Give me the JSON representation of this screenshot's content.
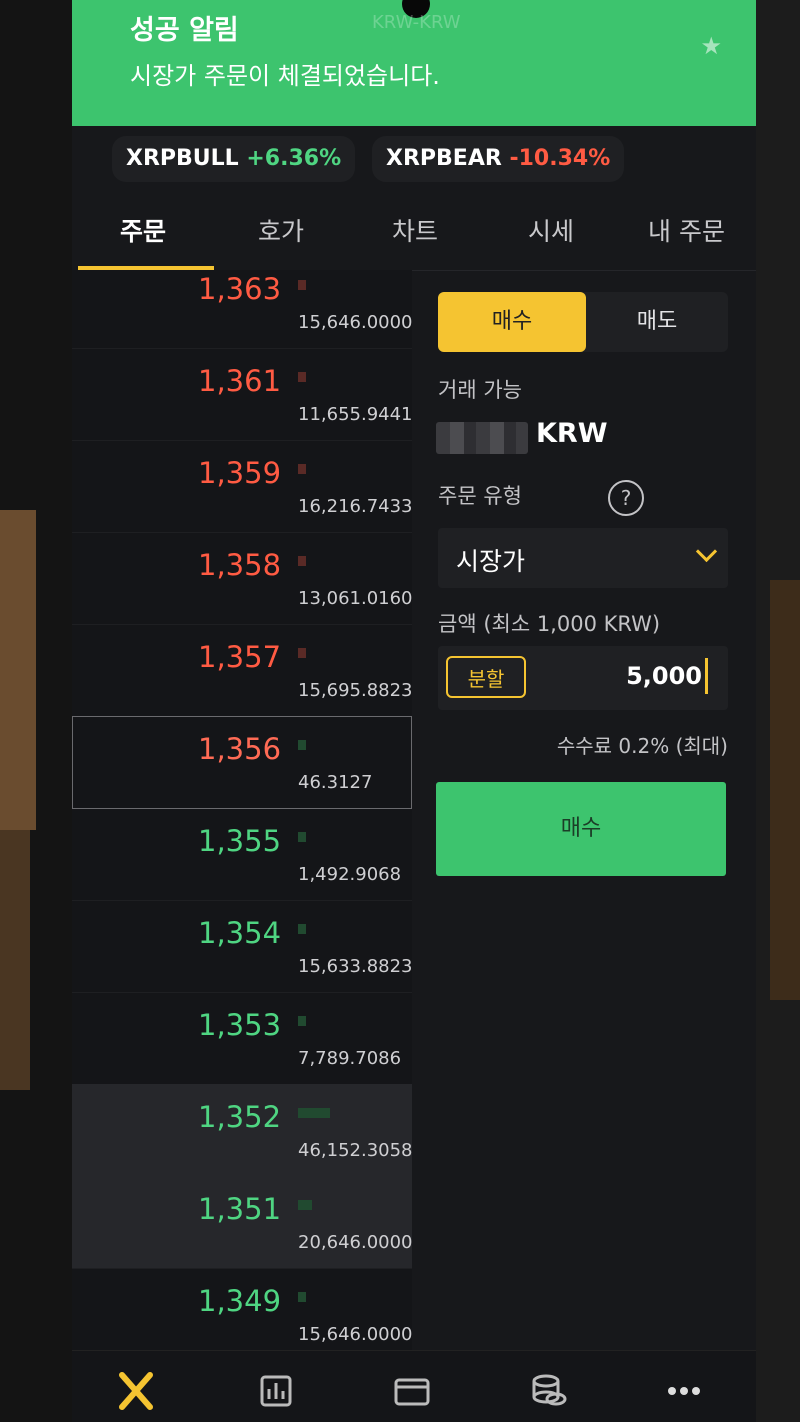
{
  "notification": {
    "title": "성공 알림",
    "message": "시장가 주문이 체결되었습니다.",
    "ghost_text": "KRW-KRW"
  },
  "tickers": [
    {
      "symbol": "XRPBULL",
      "change": "+6.36%",
      "direction": "up"
    },
    {
      "symbol": "XRPBEAR",
      "change": "-10.34%",
      "direction": "down"
    }
  ],
  "tabs": [
    {
      "label": "주문",
      "active": true
    },
    {
      "label": "호가",
      "active": false
    },
    {
      "label": "차트",
      "active": false
    },
    {
      "label": "시세",
      "active": false
    },
    {
      "label": "내 주문",
      "active": false
    }
  ],
  "orderbook": [
    {
      "price": "1,363",
      "qty": "15,646.0000",
      "side": "ask"
    },
    {
      "price": "1,361",
      "qty": "11,655.9441",
      "side": "ask"
    },
    {
      "price": "1,359",
      "qty": "16,216.7433",
      "side": "ask"
    },
    {
      "price": "1,358",
      "qty": "13,061.0160",
      "side": "ask"
    },
    {
      "price": "1,357",
      "qty": "15,695.8823",
      "side": "ask"
    },
    {
      "price": "1,356",
      "qty": "46.3127",
      "side": "current"
    },
    {
      "price": "1,355",
      "qty": "1,492.9068",
      "side": "bid"
    },
    {
      "price": "1,354",
      "qty": "15,633.8823",
      "side": "bid"
    },
    {
      "price": "1,353",
      "qty": "7,789.7086",
      "side": "bid"
    },
    {
      "price": "1,352",
      "qty": "46,152.3058",
      "side": "bid",
      "highlight": true
    },
    {
      "price": "1,351",
      "qty": "20,646.0000",
      "side": "bid",
      "highlight": true
    },
    {
      "price": "1,349",
      "qty": "15,646.0000",
      "side": "bid"
    }
  ],
  "order_panel": {
    "buy_tab": "매수",
    "sell_tab": "매도",
    "available_label": "거래 가능",
    "currency": "KRW",
    "order_type_label": "주문 유형",
    "help_symbol": "?",
    "order_type_value": "시장가",
    "amount_label": "금액 (최소 1,000 KRW)",
    "split_button": "분할",
    "amount_value": "5,000",
    "fee_text": "수수료 0.2% (최대)",
    "submit_label": "매수"
  },
  "colors": {
    "accent": "#f5c431",
    "buy_green": "#3dc46e",
    "up": "#4fd582",
    "down": "#ff5b43"
  },
  "bottom_nav": [
    {
      "icon": "x-logo-icon"
    },
    {
      "icon": "bar-chart-icon"
    },
    {
      "icon": "wallet-icon"
    },
    {
      "icon": "coins-icon"
    },
    {
      "icon": "more-icon"
    }
  ]
}
